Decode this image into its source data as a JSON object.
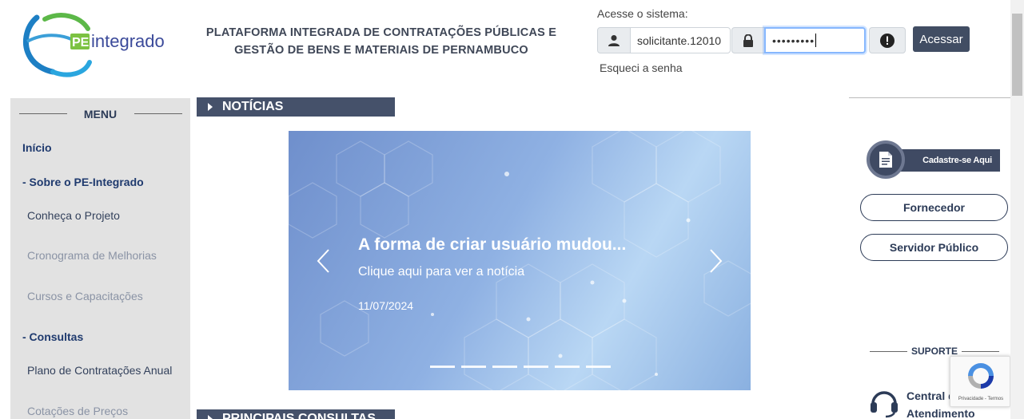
{
  "header": {
    "platform_title_line1": "PLATAFORMA INTEGRADA DE CONTRATAÇÕES PÚBLICAS E",
    "platform_title_line2": "GESTÃO DE BENS E MATERIAIS DE PERNAMBUCO",
    "logo": {
      "prefix": "PE",
      "name": "integrado"
    }
  },
  "login": {
    "label": "Acesse o sistema:",
    "username_value": "solicitante.12010",
    "password_value": "•••••••••",
    "submit_label": "Acessar",
    "forgot_label": "Esqueci a senha",
    "icons": {
      "user": "user-icon",
      "lock": "lock-icon",
      "alert": "alert-icon"
    }
  },
  "menu": {
    "title": "MENU",
    "items": [
      {
        "label": "Início"
      },
      {
        "label": "- Sobre o PE-Integrado"
      },
      {
        "label": "Conheça o Projeto"
      },
      {
        "label": "Cronograma de Melhorias"
      },
      {
        "label": "Cursos e Capacitações"
      },
      {
        "label": "- Consultas"
      },
      {
        "label": "Plano de Contratações Anual"
      },
      {
        "label": "Cotações de Preços"
      }
    ]
  },
  "news": {
    "section_title": "NOTÍCIAS",
    "slide": {
      "title": "A forma de criar usuário mudou...",
      "subtitle": "Clique aqui para ver a notícia",
      "date": "11/07/2024"
    },
    "indicator_count": 6
  },
  "consultas": {
    "section_title": "PRINCIPAIS CONSULTAS"
  },
  "sidebar_right": {
    "register_label": "Cadastre-se Aqui",
    "fornecedor_label": "Fornecedor",
    "servidor_label": "Servidor Público",
    "support_title": "SUPORTE",
    "central_line1": "Central de",
    "central_line2": "Atendimento"
  },
  "recaptcha": {
    "text": "Privacidade - Termos"
  },
  "colors": {
    "brand_dark": "#414d63",
    "section_bar": "#45516a",
    "menu_bg": "#e2e2e2",
    "link_blue": "#1f3a6e"
  }
}
